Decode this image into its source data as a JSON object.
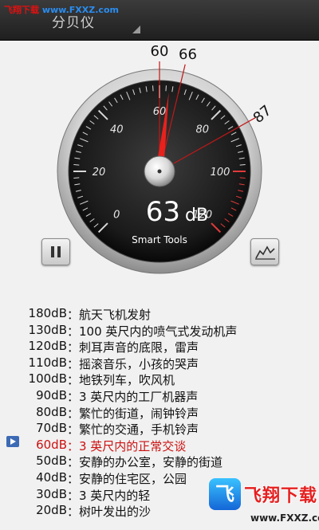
{
  "watermark_top": {
    "part1": "飞翔下载",
    "part2": " www.FXXZ.com"
  },
  "header": {
    "title": "分贝仪"
  },
  "gauge": {
    "scale_min": 0,
    "scale_max": 120,
    "major_ticks": [
      "0",
      "20",
      "40",
      "60",
      "80",
      "100",
      "120"
    ],
    "current_value": 63,
    "current_display": "63",
    "unit": "dB",
    "brand": "Smart Tools",
    "markers": [
      {
        "label": "60",
        "value": 60,
        "color": "#111111"
      },
      {
        "label": "66",
        "value": 66,
        "color": "#111111"
      },
      {
        "label": "87",
        "value": 87,
        "color": "#111111"
      }
    ]
  },
  "buttons": {
    "pause": "pause-icon",
    "chart": "chart-icon"
  },
  "levels": [
    {
      "db": "180dB",
      "desc": "：航天飞机发射"
    },
    {
      "db": "130dB",
      "desc": "：100 英尺内的喷气式发动机声"
    },
    {
      "db": "120dB",
      "desc": "：刺耳声音的底限，雷声"
    },
    {
      "db": "110dB",
      "desc": "：摇滚音乐，小孩的哭声"
    },
    {
      "db": "100dB",
      "desc": "：地铁列车，吹风机"
    },
    {
      "db": "90dB",
      "desc": "：3 英尺内的工厂机器声"
    },
    {
      "db": "80dB",
      "desc": "：繁忙的街道，闹钟铃声"
    },
    {
      "db": "70dB",
      "desc": "：繁忙的交通，手机铃声"
    },
    {
      "db": "60dB",
      "desc": "：3 英尺内的正常交谈",
      "current": true
    },
    {
      "db": "50dB",
      "desc": "：安静的办公室，安静的街道"
    },
    {
      "db": "40dB",
      "desc": "：安静的住宅区，公园"
    },
    {
      "db": "30dB",
      "desc": "：3 英尺内的轻"
    },
    {
      "db": "20dB",
      "desc": "：树叶发出的沙"
    }
  ],
  "watermark_bottom": {
    "logo": "飞",
    "name": "飞翔下载",
    "url": "www.FXXZ.com"
  },
  "colors": {
    "accent_current": "#cc1111",
    "needle": "#e8211d",
    "marker_line": "#c01818"
  }
}
